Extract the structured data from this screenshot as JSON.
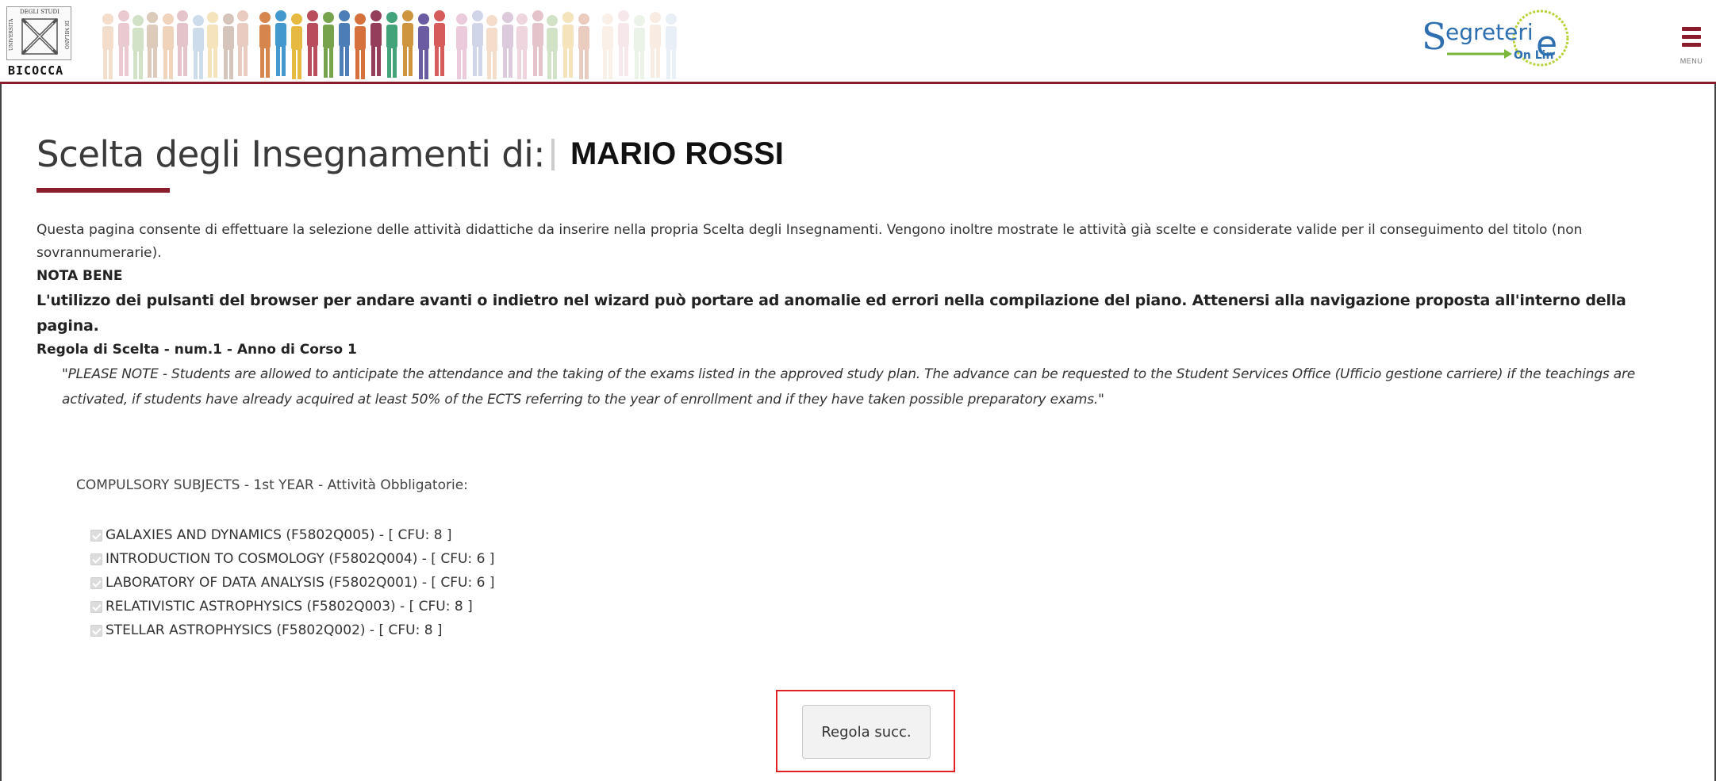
{
  "header": {
    "logo_word": "BICOCCA",
    "logo_top_text": "DEGLI STUDI",
    "logo_left_text": "UNIVERSITÀ",
    "logo_right_text": "DI MILANO",
    "segreterie_top": "Segreterie",
    "segreterie_sub": "On Line",
    "menu_label": "MENU",
    "brand_color": "#8a1c2b"
  },
  "page": {
    "title": "Scelta degli Insegnamenti di:",
    "student_name": "MARIO ROSSI",
    "intro": "Questa pagina consente di effettuare la selezione delle attività didattiche da inserire nella propria Scelta degli Insegnamenti. Vengono inoltre mostrate le attività già scelte e considerate valide per il conseguimento del titolo (non sovrannumerarie).",
    "nota_bene_label": "NOTA BENE",
    "nota_bene_text": "L'utilizzo dei pulsanti del browser per andare avanti o indietro nel wizard può portare ad anomalie ed errori nella compilazione del piano. Attenersi alla navigazione proposta all'interno della pagina.",
    "rule_title": "Regola di Scelta - num.1 - Anno di Corso 1",
    "rule_note": "\"PLEASE NOTE - Students are allowed to anticipate the attendance and the taking of the exams listed in the approved study plan. The advance can be requested to the Student Services Office (Ufficio gestione carriere) if the teachings are activated, if students have already acquired at least 50% of the ECTS referring to the year of enrollment and if they have taken possible preparatory exams.\""
  },
  "group": {
    "title": "COMPULSORY SUBJECTS - 1st YEAR - Attività Obbligatorie:",
    "courses": [
      {
        "label": "GALAXIES AND DYNAMICS (F5802Q005) - [ CFU: 8 ]",
        "checked": true
      },
      {
        "label": "INTRODUCTION TO COSMOLOGY (F5802Q004) - [ CFU: 6 ]",
        "checked": true
      },
      {
        "label": "LABORATORY OF DATA ANALYSIS (F5802Q001) - [ CFU: 6 ]",
        "checked": true
      },
      {
        "label": "RELATIVISTIC ASTROPHYSICS (F5802Q003) - [ CFU: 8 ]",
        "checked": true
      },
      {
        "label": "STELLAR ASTROPHYSICS (F5802Q002) - [ CFU: 8 ]",
        "checked": true
      }
    ]
  },
  "actions": {
    "next_rule_label": "Regola succ.",
    "highlight_color": "#e02020"
  }
}
